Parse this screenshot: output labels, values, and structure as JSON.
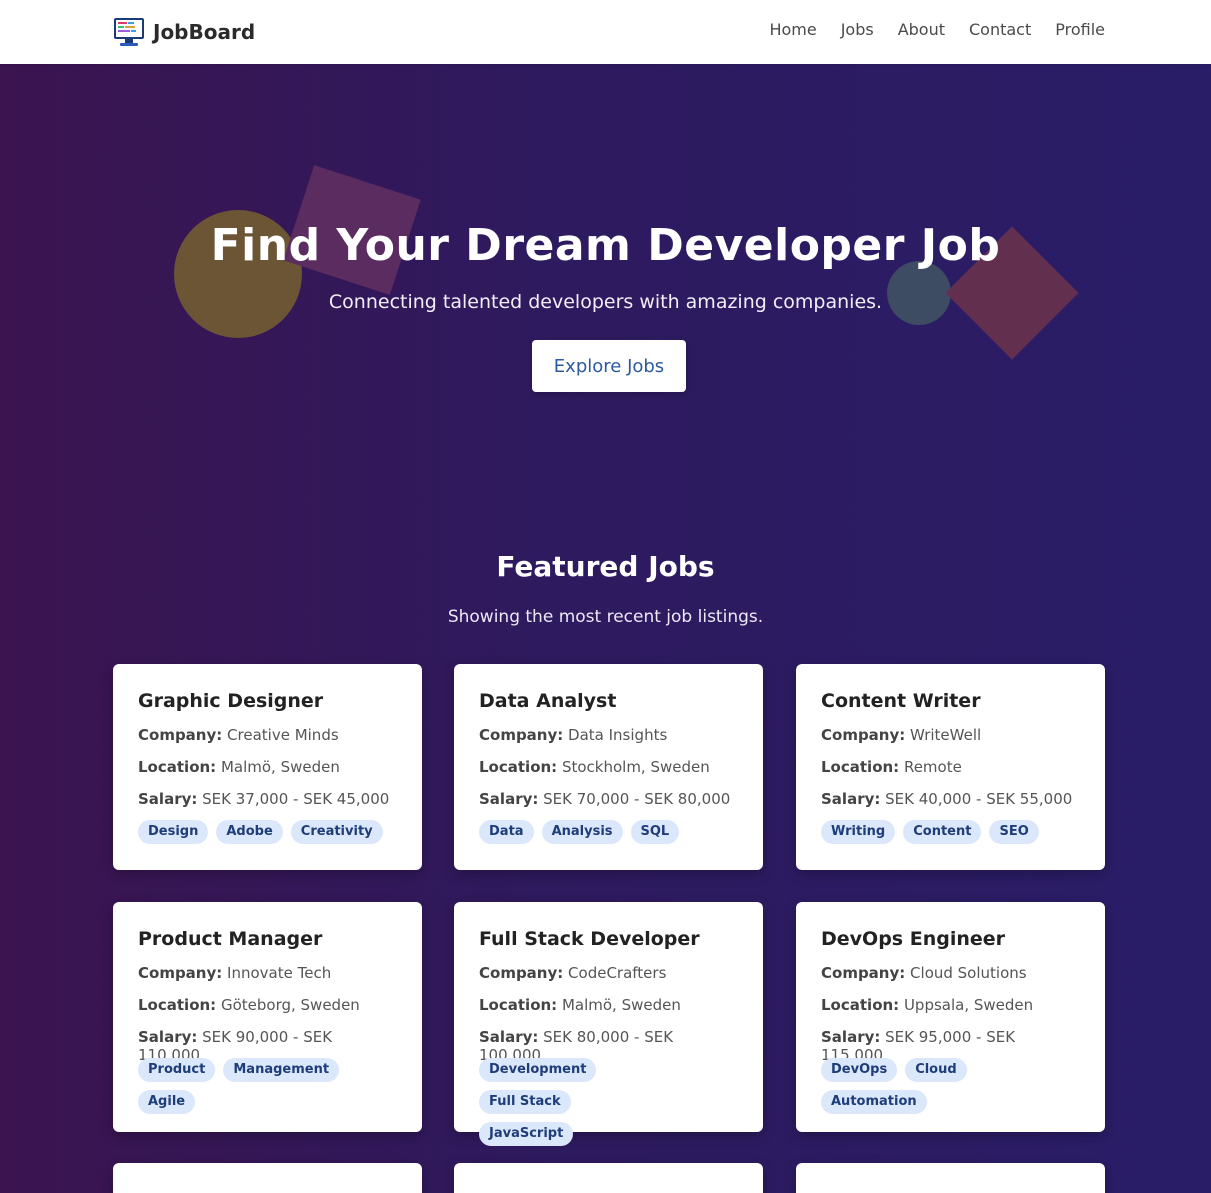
{
  "brand": {
    "name": "JobBoard",
    "icon": "monitor-icon"
  },
  "nav": {
    "items": [
      "Home",
      "Jobs",
      "About",
      "Contact",
      "Profile"
    ]
  },
  "hero": {
    "title": "Find Your Dream Developer Job",
    "subtitle": "Connecting talented developers with amazing companies.",
    "button": "Explore Jobs"
  },
  "featured": {
    "title": "Featured Jobs",
    "subtitle": "Showing the most recent job listings.",
    "labels": {
      "company": "Company:",
      "location": "Location:",
      "salary": "Salary:"
    },
    "jobs": [
      {
        "title": "Graphic Designer",
        "company": "Creative Minds",
        "location": "Malmö, Sweden",
        "salary": "SEK 37,000 - SEK 45,000",
        "tags": [
          "Design",
          "Adobe",
          "Creativity"
        ]
      },
      {
        "title": "Data Analyst",
        "company": "Data Insights",
        "location": "Stockholm, Sweden",
        "salary": "SEK 70,000 - SEK 80,000",
        "tags": [
          "Data",
          "Analysis",
          "SQL"
        ]
      },
      {
        "title": "Content Writer",
        "company": "WriteWell",
        "location": "Remote",
        "salary": "SEK 40,000 - SEK 55,000",
        "tags": [
          "Writing",
          "Content",
          "SEO"
        ]
      },
      {
        "title": "Product Manager",
        "company": "Innovate Tech",
        "location": "Göteborg, Sweden",
        "salary": "SEK 90,000 - SEK 110,000",
        "tags": [
          "Product",
          "Management",
          "Agile"
        ]
      },
      {
        "title": "Full Stack Developer",
        "company": "CodeCrafters",
        "location": "Malmö, Sweden",
        "salary": "SEK 80,000 - SEK 100,000",
        "tags": [
          "Development",
          "Full Stack",
          "JavaScript"
        ]
      },
      {
        "title": "DevOps Engineer",
        "company": "Cloud Solutions",
        "location": "Uppsala, Sweden",
        "salary": "SEK 95,000 - SEK 115,000",
        "tags": [
          "DevOps",
          "Cloud",
          "Automation"
        ]
      }
    ]
  },
  "colors": {
    "accent": "#2c5aa0",
    "tag_bg": "#dbe7fb",
    "tag_text": "#1f3d78"
  }
}
